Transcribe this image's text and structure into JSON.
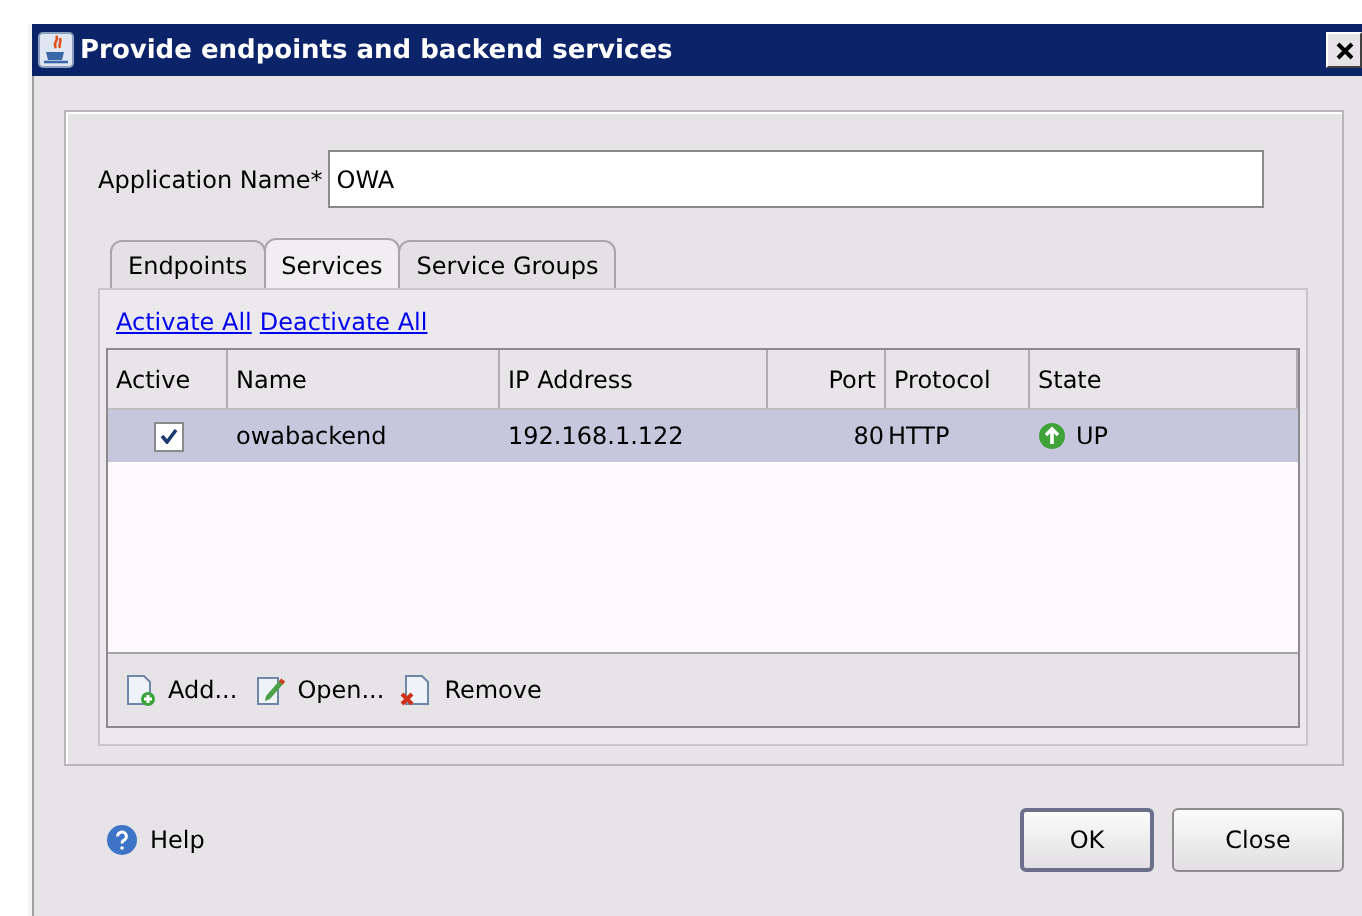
{
  "window": {
    "title": "Provide endpoints and backend services"
  },
  "application_name": {
    "label": "Application Name*",
    "value": "OWA"
  },
  "tabs": [
    {
      "label": "Endpoints",
      "selected": false
    },
    {
      "label": "Services",
      "selected": true
    },
    {
      "label": "Service Groups",
      "selected": false
    }
  ],
  "links": [
    "Activate All",
    "Deactivate All"
  ],
  "table": {
    "columns": [
      "Active",
      "Name",
      "IP Address",
      "Port",
      "Protocol",
      "State"
    ],
    "rows": [
      {
        "active": true,
        "selected": true,
        "name": "owabackend",
        "ip": "192.168.1.122",
        "port": "80",
        "protocol": "HTTP",
        "state": "UP"
      }
    ]
  },
  "toolbar": [
    {
      "kind": "add",
      "label": "Add..."
    },
    {
      "kind": "open",
      "label": "Open..."
    },
    {
      "kind": "remove",
      "label": "Remove"
    }
  ],
  "help": "Help",
  "buttons": [
    {
      "label": "OK",
      "default": true
    },
    {
      "label": "Close",
      "default": false
    }
  ]
}
